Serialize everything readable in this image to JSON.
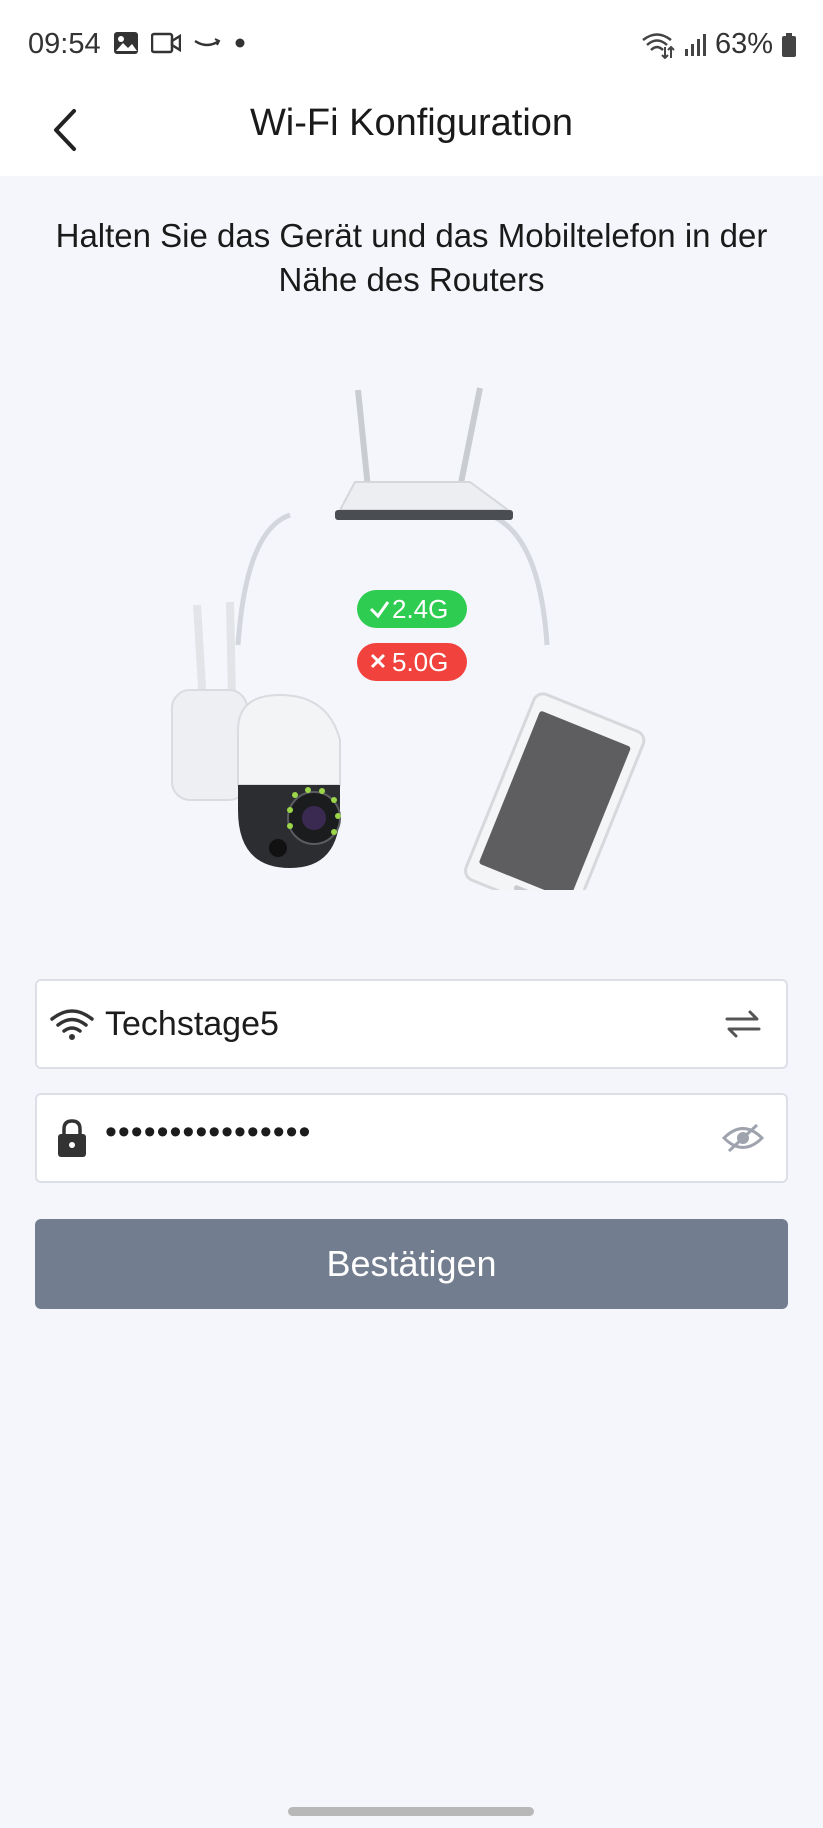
{
  "status_bar": {
    "time": "09:54",
    "battery": "63%"
  },
  "header": {
    "title": "Wi-Fi Konfiguration"
  },
  "instruction": "Halten Sie das Gerät und das Mobiltelefon in der Nähe des Routers",
  "illustration": {
    "badge_ok": "2.4G",
    "badge_bad": "5.0G",
    "colors": {
      "ok": "#2fcc52",
      "bad": "#f2423d"
    }
  },
  "wifi": {
    "ssid": "Techstage5",
    "password_masked": "••••••••••••••••"
  },
  "confirm_button": "Bestätigen",
  "colors": {
    "accent_button": "#737d90",
    "background": "#f4f6fc"
  }
}
